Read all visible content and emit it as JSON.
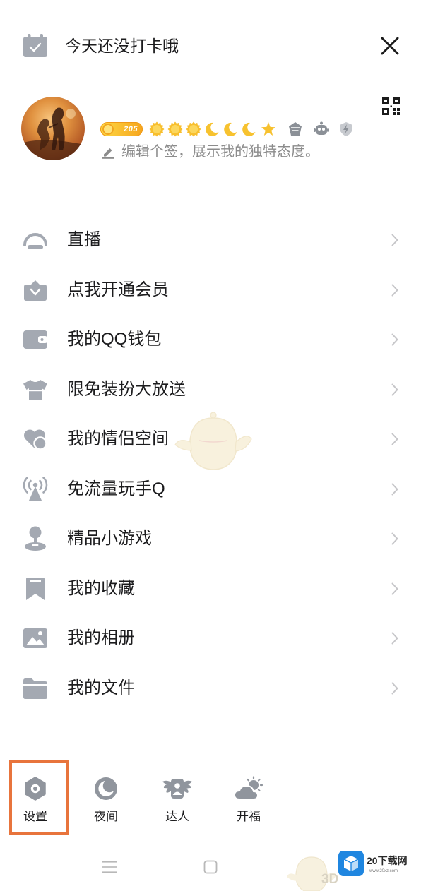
{
  "header": {
    "checkin_label": "今天还没打卡哦",
    "checkin_icon": "calendar-check-icon",
    "close_icon": "close-icon"
  },
  "profile": {
    "avatar": "avatar-image",
    "qr_icon": "qr-code-icon",
    "level": "205",
    "badges": [
      "sun-icon",
      "sun-icon",
      "sun-icon",
      "moon-icon",
      "moon-icon",
      "moon-icon",
      "star-icon"
    ],
    "privilege_icons": [
      "diamond-badge-icon",
      "robot-badge-icon",
      "lightning-badge-icon"
    ],
    "signature_icon": "pencil-icon",
    "signature": "编辑个签，展示我的独特态度。"
  },
  "menu": [
    {
      "label": "直播",
      "icon": "live-icon"
    },
    {
      "label": "点我开通会员",
      "icon": "vip-bag-icon"
    },
    {
      "label": "我的QQ钱包",
      "icon": "wallet-icon"
    },
    {
      "label": "限免装扮大放送",
      "icon": "shirt-icon"
    },
    {
      "label": "我的情侣空间",
      "icon": "couple-heart-icon"
    },
    {
      "label": "免流量玩手Q",
      "icon": "signal-tower-icon"
    },
    {
      "label": "精品小游戏",
      "icon": "joystick-icon"
    },
    {
      "label": "我的收藏",
      "icon": "bookmark-icon"
    },
    {
      "label": "我的相册",
      "icon": "photo-icon"
    },
    {
      "label": "我的文件",
      "icon": "folder-icon"
    }
  ],
  "bottom_actions": [
    {
      "label": "设置",
      "icon": "settings-icon",
      "highlighted": true
    },
    {
      "label": "夜间",
      "icon": "night-mode-icon",
      "highlighted": false
    },
    {
      "label": "达人",
      "icon": "talent-wings-icon",
      "highlighted": false
    },
    {
      "label": "开福",
      "icon": "weather-icon",
      "highlighted": false
    }
  ],
  "nav_bar": {
    "icons": [
      "recent-apps-icon",
      "home-icon"
    ]
  },
  "watermark": {
    "site_name": "20下载网",
    "url": "www.20xz.com",
    "mascot_text": "3D"
  },
  "colors": {
    "text": "#1c1c1e",
    "icon": "#a4a9b2",
    "action_icon": "#90959d",
    "chevron": "#c6c6c9",
    "secondary": "#8c8c8c",
    "highlight_border": "#e8743c",
    "badge_gold": "#f8bf2e"
  }
}
